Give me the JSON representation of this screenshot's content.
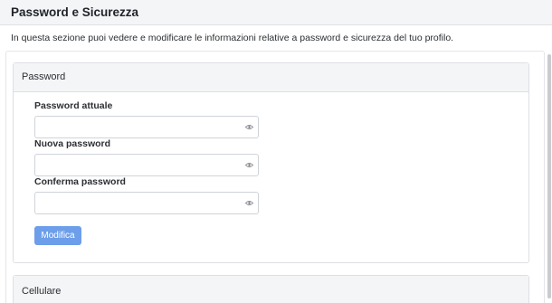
{
  "page": {
    "title": "Password e Sicurezza",
    "intro": "In questa sezione puoi vedere e modificare le informazioni relative a password e sicurezza del tuo profilo."
  },
  "password_card": {
    "header": "Password",
    "fields": [
      {
        "label": "Password attuale",
        "value": "",
        "icon": "eye-icon"
      },
      {
        "label": "Nuova password",
        "value": "",
        "icon": "eye-icon"
      },
      {
        "label": "Conferma password",
        "value": "",
        "icon": "eye-icon"
      }
    ],
    "submit_label": "Modifica",
    "submit_color": "#6c9ee9"
  },
  "cellulare_card": {
    "header": "Cellulare"
  }
}
